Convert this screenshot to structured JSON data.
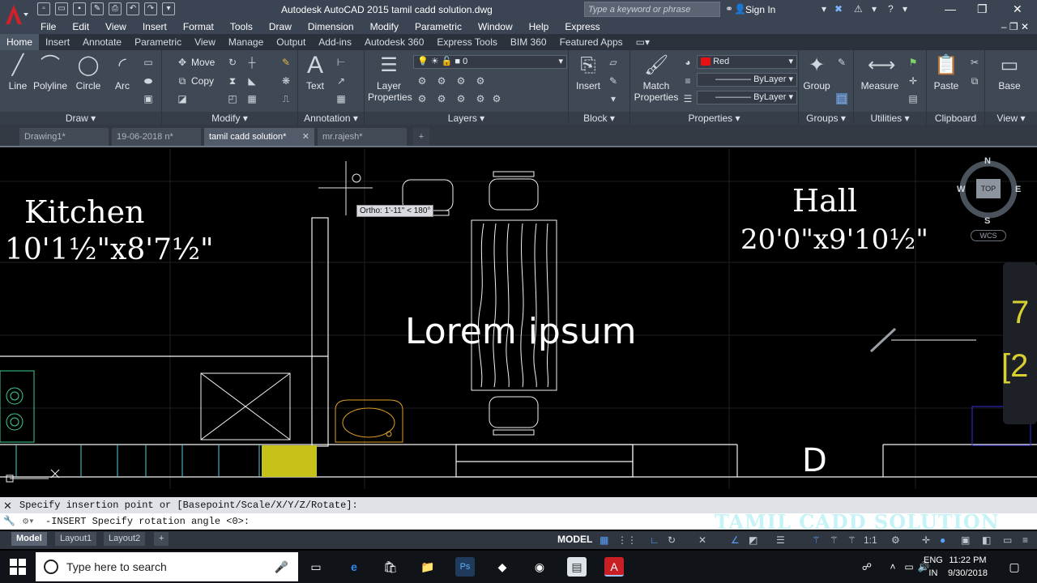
{
  "titlebar": {
    "app_title": "Autodesk AutoCAD 2015    tamil cadd solution.dwg",
    "search_placeholder": "Type a keyword or phrase",
    "sign_in": "Sign In"
  },
  "menubar": [
    "File",
    "Edit",
    "View",
    "Insert",
    "Format",
    "Tools",
    "Draw",
    "Dimension",
    "Modify",
    "Parametric",
    "Window",
    "Help",
    "Express"
  ],
  "ribbon_tabs": [
    "Home",
    "Insert",
    "Annotate",
    "Parametric",
    "View",
    "Manage",
    "Output",
    "Add-ins",
    "Autodesk 360",
    "Express Tools",
    "BIM 360",
    "Featured Apps"
  ],
  "ribbon": {
    "draw": {
      "title": "Draw",
      "line": "Line",
      "polyline": "Polyline",
      "circle": "Circle",
      "arc": "Arc"
    },
    "modify": {
      "title": "Modify",
      "move": "Move",
      "copy": "Copy"
    },
    "annotation": {
      "title": "Annotation",
      "text": "Text"
    },
    "layers": {
      "title": "Layers",
      "layer_properties": "Layer\nProperties",
      "layer_value": "0"
    },
    "block": {
      "title": "Block",
      "insert": "Insert"
    },
    "properties": {
      "title": "Properties",
      "match": "Match\nProperties",
      "color": "Red",
      "linetype": "ByLayer",
      "lineweight": "ByLayer",
      "color_hex": "#e81010"
    },
    "groups": {
      "title": "Groups",
      "group": "Group"
    },
    "utilities": {
      "title": "Utilities",
      "measure": "Measure"
    },
    "clipboard": {
      "title": "Clipboard",
      "paste": "Paste"
    },
    "view": {
      "title": "View",
      "base": "Base"
    }
  },
  "doc_tabs": [
    "Drawing1*",
    "19-06-2018 n*",
    "tamil cadd solution*",
    "mr.rajesh*"
  ],
  "canvas": {
    "kitchen_name": "Kitchen",
    "kitchen_size": "10'1½\"x8'7½\"",
    "hall_name": "Hall",
    "hall_size": "20'0\"x9'10½\"",
    "overlay_text": "Lorem ipsum",
    "ortho_tooltip": "Ortho: 1'-11\" < 180°",
    "door_label": "D",
    "edge_text_1": "7",
    "edge_text_2": "[2"
  },
  "viewcube": {
    "n": "N",
    "s": "S",
    "e": "E",
    "w": "W",
    "top": "TOP",
    "wcs": "WCS"
  },
  "command": {
    "history": "Specify insertion point or [Basepoint/Scale/X/Y/Z/Rotate]:",
    "current": "-INSERT Specify rotation angle <0>:"
  },
  "watermark": "TAMIL CADD SOLUTION",
  "status": {
    "layout_tabs": [
      "Model",
      "Layout1",
      "Layout2"
    ],
    "model": "MODEL",
    "scale": "1:1"
  },
  "taskbar": {
    "search_placeholder": "Type here to search",
    "lang_1": "ENG",
    "lang_2": "IN",
    "time": "11:22 PM",
    "date": "9/30/2018"
  }
}
